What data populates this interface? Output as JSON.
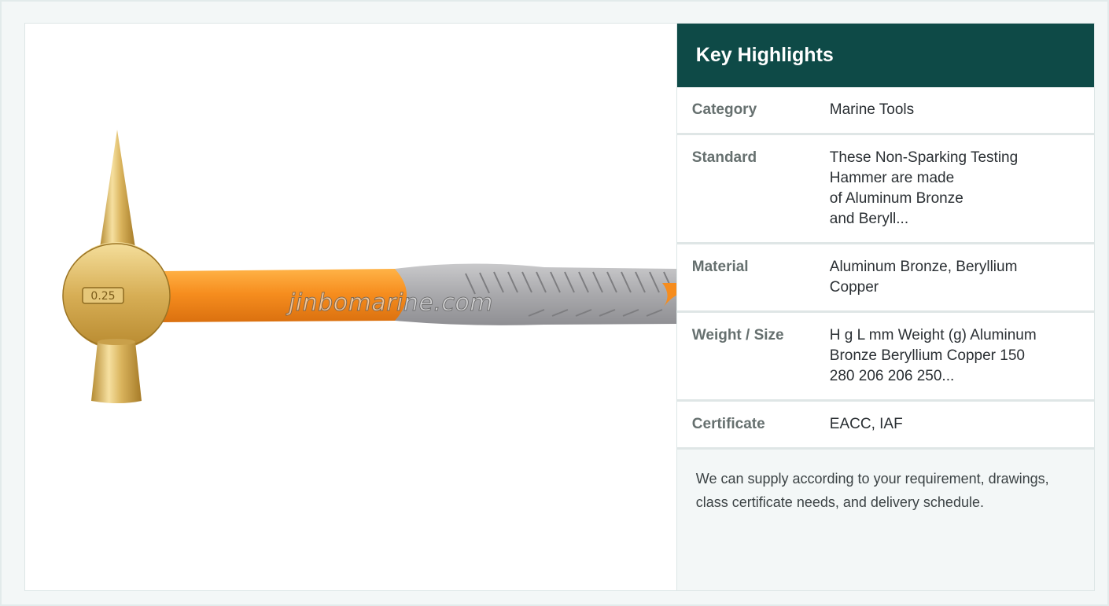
{
  "product": {
    "image_alt": "Non-Sparking Testing Hammer",
    "watermark": "jinbomarine.com",
    "stamp": "0.25"
  },
  "highlights": {
    "title": "Key Highlights",
    "rows": [
      {
        "label": "Category",
        "value": "Marine Tools"
      },
      {
        "label": "Standard",
        "value": "These Non-Sparking Testing\nHammer are made\nof Aluminum Bronze\nand Beryll..."
      },
      {
        "label": "Material",
        "value": "Aluminum Bronze, Beryllium\nCopper"
      },
      {
        "label": "Weight / Size",
        "value": "H g L mm Weight (g) Aluminum\nBronze Beryllium Copper 150\n280 206 206 250..."
      },
      {
        "label": "Certificate",
        "value": "EACC, IAF"
      }
    ],
    "note": "We can supply according to your requirement, drawings, class certificate needs, and delivery schedule."
  }
}
